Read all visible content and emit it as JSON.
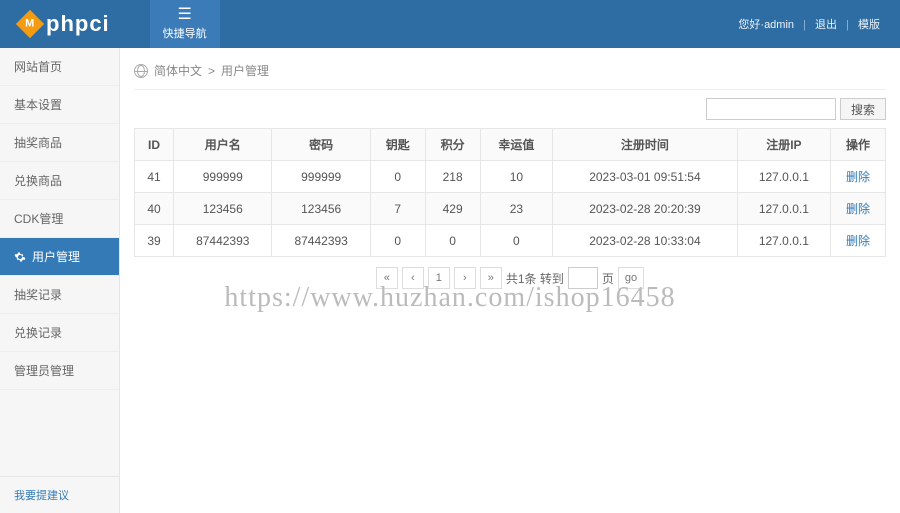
{
  "header": {
    "brand": "phpci",
    "quicknav": "快捷导航",
    "greeting": "您好·admin",
    "logout": "退出",
    "templates": "模版"
  },
  "sidebar": {
    "items": [
      "网站首页",
      "基本设置",
      "抽奖商品",
      "兑换商品",
      "CDK管理",
      "用户管理",
      "抽奖记录",
      "兑换记录",
      "管理员管理"
    ],
    "feedback": "我要提建议"
  },
  "breadcrumb": {
    "a": "简体中文",
    "sep": ">",
    "b": "用户管理"
  },
  "search": {
    "placeholder": "",
    "button": "搜索"
  },
  "table": {
    "headers": [
      "ID",
      "用户名",
      "密码",
      "钥匙",
      "积分",
      "幸运值",
      "注册时间",
      "注册IP",
      "操作"
    ],
    "rows": [
      {
        "id": "41",
        "user": "999999",
        "pass": "999999",
        "keys": "0",
        "points": "218",
        "luck": "10",
        "time": "2023-03-01 09:51:54",
        "ip": "127.0.0.1",
        "op": "删除"
      },
      {
        "id": "40",
        "user": "123456",
        "pass": "123456",
        "keys": "7",
        "points": "429",
        "luck": "23",
        "time": "2023-02-28 20:20:39",
        "ip": "127.0.0.1",
        "op": "删除"
      },
      {
        "id": "39",
        "user": "87442393",
        "pass": "87442393",
        "keys": "0",
        "points": "0",
        "luck": "0",
        "time": "2023-02-28 10:33:04",
        "ip": "127.0.0.1",
        "op": "删除"
      }
    ]
  },
  "pager": {
    "first": "«",
    "prev": "‹",
    "page": "1",
    "next": "›",
    "last": "»",
    "total": "共1条 转到",
    "unit": "页",
    "go": "go"
  },
  "watermark": "https://www.huzhan.com/ishop16458"
}
